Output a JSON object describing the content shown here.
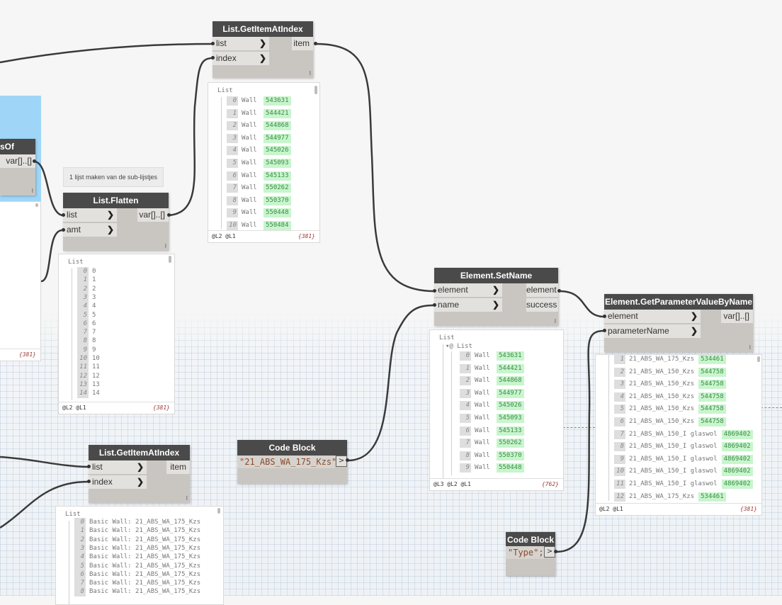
{
  "nodes": {
    "list_get_item_top": {
      "title": "List.GetItemAtIndex",
      "in1": "list",
      "in2": "index",
      "out": "item",
      "lacing": "l"
    },
    "partial_node": {
      "title": "sOf",
      "out": "var[]..[]",
      "lacing": "l"
    },
    "flatten": {
      "title": "List.Flatten",
      "in1": "list",
      "in2": "amt",
      "out": "var[]..[]",
      "lacing": "l"
    },
    "set_name": {
      "title": "Element.SetName",
      "in1": "element",
      "in2": "name",
      "out1": "element",
      "out2": "success",
      "lacing": "l"
    },
    "get_param": {
      "title": "Element.GetParameterValueByName",
      "in1": "element",
      "in2": "parameterName",
      "out": "var[]..[]",
      "lacing": "l"
    },
    "list_get_item_bottom": {
      "title": "List.GetItemAtIndex",
      "in1": "list",
      "in2": "index",
      "out": "item",
      "lacing": "l"
    },
    "code_block_1": {
      "title": "Code Block",
      "code": "\"21_ABS_WA_175_Kzs\";",
      "out": ">"
    },
    "code_block_2": {
      "title": "Code Block",
      "code": "\"Type\";",
      "out": ">"
    }
  },
  "note": {
    "text": "1 lijst maken van de sub-lijstjes"
  },
  "previews": {
    "top_get": {
      "title": "List",
      "rows": [
        {
          "i": "0",
          "t": "Wall",
          "v": "543631"
        },
        {
          "i": "1",
          "t": "Wall",
          "v": "544421"
        },
        {
          "i": "2",
          "t": "Wall",
          "v": "544868"
        },
        {
          "i": "3",
          "t": "Wall",
          "v": "544977"
        },
        {
          "i": "4",
          "t": "Wall",
          "v": "545026"
        },
        {
          "i": "5",
          "t": "Wall",
          "v": "545093"
        },
        {
          "i": "6",
          "t": "Wall",
          "v": "545133"
        },
        {
          "i": "7",
          "t": "Wall",
          "v": "550262"
        },
        {
          "i": "8",
          "t": "Wall",
          "v": "550370"
        },
        {
          "i": "9",
          "t": "Wall",
          "v": "550448"
        },
        {
          "i": "10",
          "t": "Wall",
          "v": "550484"
        }
      ],
      "levels": "@L2 @L1",
      "count": "{381}"
    },
    "partial": {
      "count": "{381}"
    },
    "flatten": {
      "title": "List",
      "rows": [
        {
          "i": "0",
          "t": "0"
        },
        {
          "i": "1",
          "t": "1"
        },
        {
          "i": "2",
          "t": "2"
        },
        {
          "i": "3",
          "t": "3"
        },
        {
          "i": "4",
          "t": "4"
        },
        {
          "i": "5",
          "t": "5"
        },
        {
          "i": "6",
          "t": "6"
        },
        {
          "i": "7",
          "t": "7"
        },
        {
          "i": "8",
          "t": "8"
        },
        {
          "i": "9",
          "t": "9"
        },
        {
          "i": "10",
          "t": "10"
        },
        {
          "i": "11",
          "t": "11"
        },
        {
          "i": "12",
          "t": "12"
        },
        {
          "i": "13",
          "t": "13"
        },
        {
          "i": "14",
          "t": "14"
        }
      ],
      "levels": "@L2 @L1",
      "count": "{381}"
    },
    "set_name": {
      "title": "List",
      "sub": "@ List",
      "rows": [
        {
          "i": "0",
          "t": "Wall",
          "v": "543631"
        },
        {
          "i": "1",
          "t": "Wall",
          "v": "544421"
        },
        {
          "i": "2",
          "t": "Wall",
          "v": "544868"
        },
        {
          "i": "3",
          "t": "Wall",
          "v": "544977"
        },
        {
          "i": "4",
          "t": "Wall",
          "v": "545026"
        },
        {
          "i": "5",
          "t": "Wall",
          "v": "545093"
        },
        {
          "i": "6",
          "t": "Wall",
          "v": "545133"
        },
        {
          "i": "7",
          "t": "Wall",
          "v": "550262"
        },
        {
          "i": "8",
          "t": "Wall",
          "v": "550370"
        },
        {
          "i": "9",
          "t": "Wall",
          "v": "550448"
        }
      ],
      "levels": "@L3 @L2 @L1",
      "count": "{762}"
    },
    "get_param": {
      "rows": [
        {
          "i": "1",
          "t": "21_ABS_WA_175_Kzs",
          "v": "534461"
        },
        {
          "i": "2",
          "t": "21_ABS_WA_150_Kzs",
          "v": "544758"
        },
        {
          "i": "3",
          "t": "21_ABS_WA_150_Kzs",
          "v": "544758"
        },
        {
          "i": "4",
          "t": "21_ABS_WA_150_Kzs",
          "v": "544758"
        },
        {
          "i": "5",
          "t": "21_ABS_WA_150_Kzs",
          "v": "544758"
        },
        {
          "i": "6",
          "t": "21_ABS_WA_150_Kzs",
          "v": "544758"
        },
        {
          "i": "7",
          "t": "21_ABS_WA_150_I glaswol",
          "v": "4869402"
        },
        {
          "i": "8",
          "t": "21_ABS_WA_150_I glaswol",
          "v": "4869402"
        },
        {
          "i": "9",
          "t": "21_ABS_WA_150_I glaswol",
          "v": "4869402"
        },
        {
          "i": "10",
          "t": "21_ABS_WA_150_I glaswol",
          "v": "4869402"
        },
        {
          "i": "11",
          "t": "21_ABS_WA_150_I glaswol",
          "v": "4869402"
        },
        {
          "i": "12",
          "t": "21_ABS_WA_175_Kzs",
          "v": "534461"
        }
      ],
      "levels": "@L2 @L1",
      "count": "{381}"
    },
    "bottom_get": {
      "title": "List",
      "rows": [
        {
          "i": "0",
          "t": "Basic Wall: 21_ABS_WA_175_Kzs"
        },
        {
          "i": "1",
          "t": "Basic Wall: 21_ABS_WA_175_Kzs"
        },
        {
          "i": "2",
          "t": "Basic Wall: 21_ABS_WA_175_Kzs"
        },
        {
          "i": "3",
          "t": "Basic Wall: 21_ABS_WA_175_Kzs"
        },
        {
          "i": "4",
          "t": "Basic Wall: 21_ABS_WA_175_Kzs"
        },
        {
          "i": "5",
          "t": "Basic Wall: 21_ABS_WA_175_Kzs"
        },
        {
          "i": "6",
          "t": "Basic Wall: 21_ABS_WA_175_Kzs"
        },
        {
          "i": "7",
          "t": "Basic Wall: 21_ABS_WA_175_Kzs"
        },
        {
          "i": "8",
          "t": "Basic Wall: 21_ABS_WA_175_Kzs"
        }
      ]
    }
  }
}
